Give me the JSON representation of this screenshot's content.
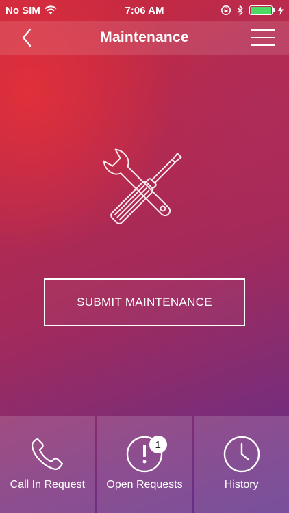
{
  "status_bar": {
    "carrier": "No SIM",
    "time": "7:06 AM",
    "battery_color": "#4cd964"
  },
  "nav": {
    "title": "Maintenance",
    "back_icon": "chevron-left-icon",
    "menu_icon": "hamburger-menu-icon"
  },
  "main": {
    "illustration_icon": "screwdriver-wrench-icon",
    "submit_label": "SUBMIT MAINTENANCE"
  },
  "tabs": [
    {
      "label": "Call In Request",
      "icon": "phone-icon"
    },
    {
      "label": "Open Requests",
      "icon": "exclamation-circle-icon",
      "badge": "1"
    },
    {
      "label": "History",
      "icon": "clock-icon"
    }
  ]
}
